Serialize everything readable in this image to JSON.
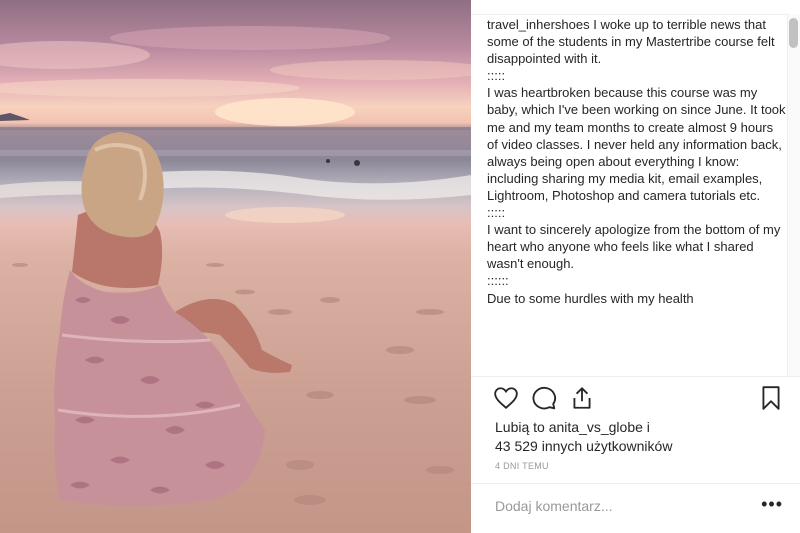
{
  "photo": {
    "alt_icon": "beach-photo"
  },
  "post": {
    "username": "travel_inhershoes",
    "caption_lines": [
      "I woke up to terrible news that some of the students in my Mastertribe course felt disappointed with it.",
      ":::::",
      "I was heartbroken because this course was my baby, which I've been working on since June. It took me and my team months to create almost 9 hours of video classes. I never held any information back, always being open about everything I know: including sharing my media kit, email examples, Lightroom, Photoshop and camera tutorials etc.",
      ":::::",
      "I want to sincerely apologize from the bottom of my heart who anyone who feels like what I shared wasn't enough.",
      "::::::",
      "Due to some hurdles with my health"
    ]
  },
  "actions": {
    "like_icon": "heart-icon",
    "comment_icon": "comment-icon",
    "share_icon": "share-icon",
    "save_icon": "bookmark-icon"
  },
  "likes": {
    "line1": "Lubią to anita_vs_globe i",
    "line2": "43 529 innych użytkowników"
  },
  "timestamp": "4 DNI TEMU",
  "comment": {
    "placeholder": "Dodaj komentarz...",
    "more_label": "•••"
  }
}
